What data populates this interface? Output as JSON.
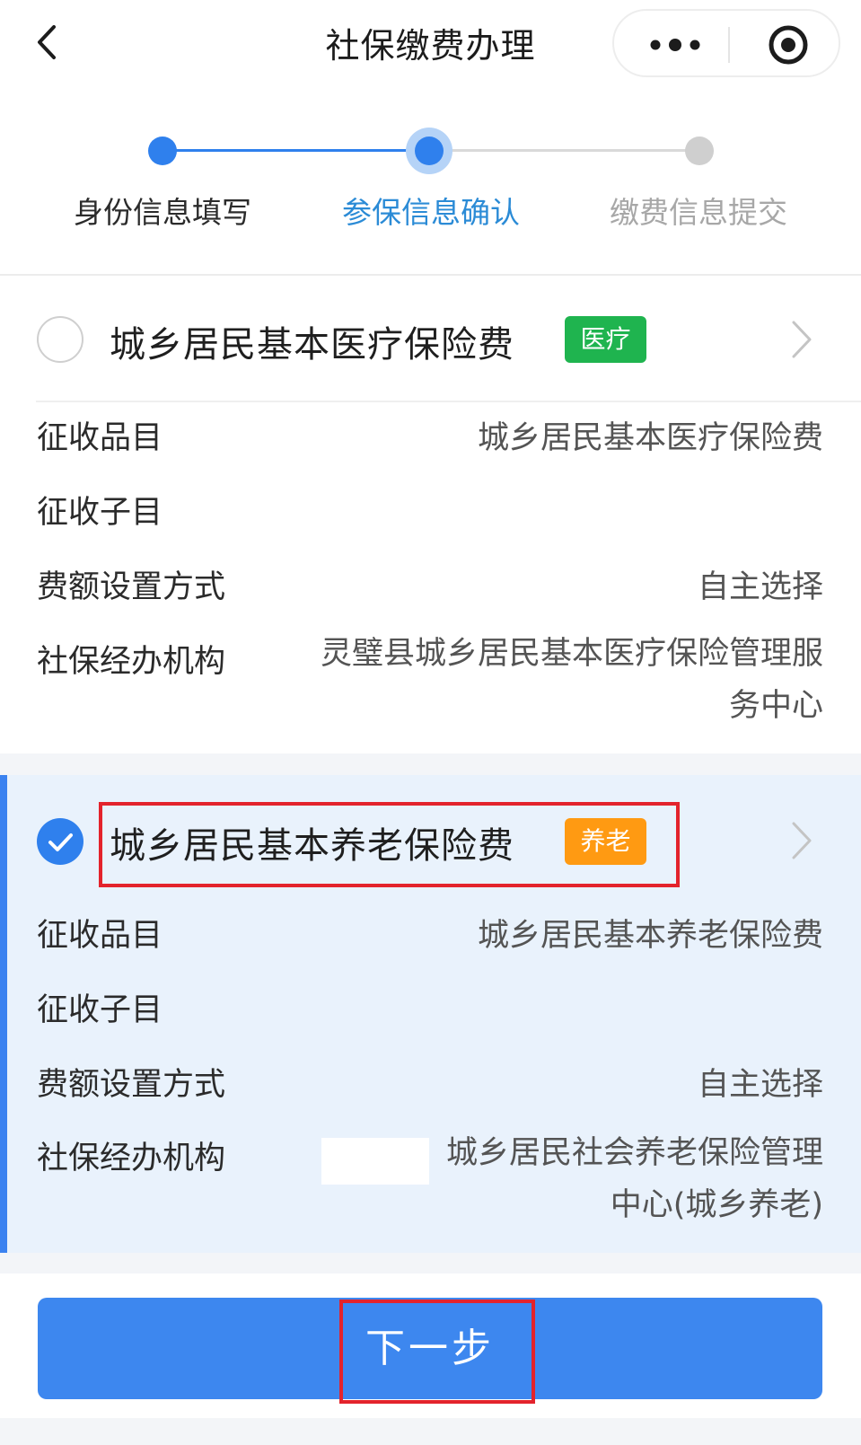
{
  "header": {
    "title": "社保缴费办理",
    "back_icon": "chevron-left-icon",
    "more_icon": "more-dots-icon",
    "close_icon": "target-circle-icon"
  },
  "steps": [
    {
      "label": "身份信息填写",
      "state": "done"
    },
    {
      "label": "参保信息确认",
      "state": "current"
    },
    {
      "label": "缴费信息提交",
      "state": "pending"
    }
  ],
  "colors": {
    "accent": "#2f80ed",
    "step_active_text": "#2b8bd6",
    "step_pending_text": "#a7a7a7",
    "tag_medical": "#1fb44f",
    "tag_pension": "#ff9a12",
    "selected_bg": "#e9f2fc",
    "highlight_border": "#e3232c"
  },
  "cards": [
    {
      "title": "城乡居民基本医疗保险费",
      "tag": "医疗",
      "selected": false,
      "rows": [
        {
          "label": "征收品目",
          "value": "城乡居民基本医疗保险费"
        },
        {
          "label": "征收子目",
          "value": ""
        },
        {
          "label": "费额设置方式",
          "value": "自主选择"
        },
        {
          "label": "社保经办机构",
          "value": "灵璧县城乡居民基本医疗保险管理服务中心"
        }
      ]
    },
    {
      "title": "城乡居民基本养老保险费",
      "tag": "养老",
      "selected": true,
      "rows": [
        {
          "label": "征收品目",
          "value": "城乡居民基本养老保险费"
        },
        {
          "label": "征收子目",
          "value": ""
        },
        {
          "label": "费额设置方式",
          "value": "自主选择"
        },
        {
          "label": "社保经办机构",
          "value": "城乡居民社会养老保险管理中心(城乡养老)"
        }
      ]
    }
  ],
  "footer": {
    "next_label": "下一步"
  }
}
